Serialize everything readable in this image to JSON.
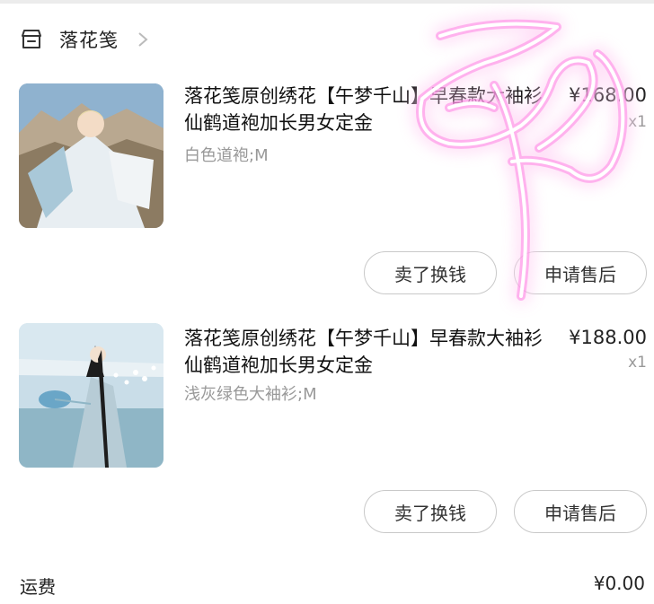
{
  "shop": {
    "name": "落花笺",
    "icon": "store-icon",
    "chevron": "chevron-right-icon"
  },
  "items": [
    {
      "title": "落花笺原创绣花【午梦千山】早春款大袖衫仙鹤道袍加长男女定金",
      "price": "¥168.00",
      "qty": "x1",
      "variant": "白色道袍;M",
      "sell_label": "卖了换钱",
      "after_sale_label": "申请售后"
    },
    {
      "title": "落花笺原创绣花【午梦千山】早春款大袖衫仙鹤道袍加长男女定金",
      "price": "¥188.00",
      "qty": "x1",
      "variant": "浅灰绿色大袖衫;M",
      "sell_label": "卖了换钱",
      "after_sale_label": "申请售后"
    }
  ],
  "shipping": {
    "label": "运费",
    "value": "¥0.00"
  },
  "colors": {
    "overlay_pink": "#ff4fd8",
    "button_border": "#c9c9c9",
    "muted_text": "#999999"
  }
}
